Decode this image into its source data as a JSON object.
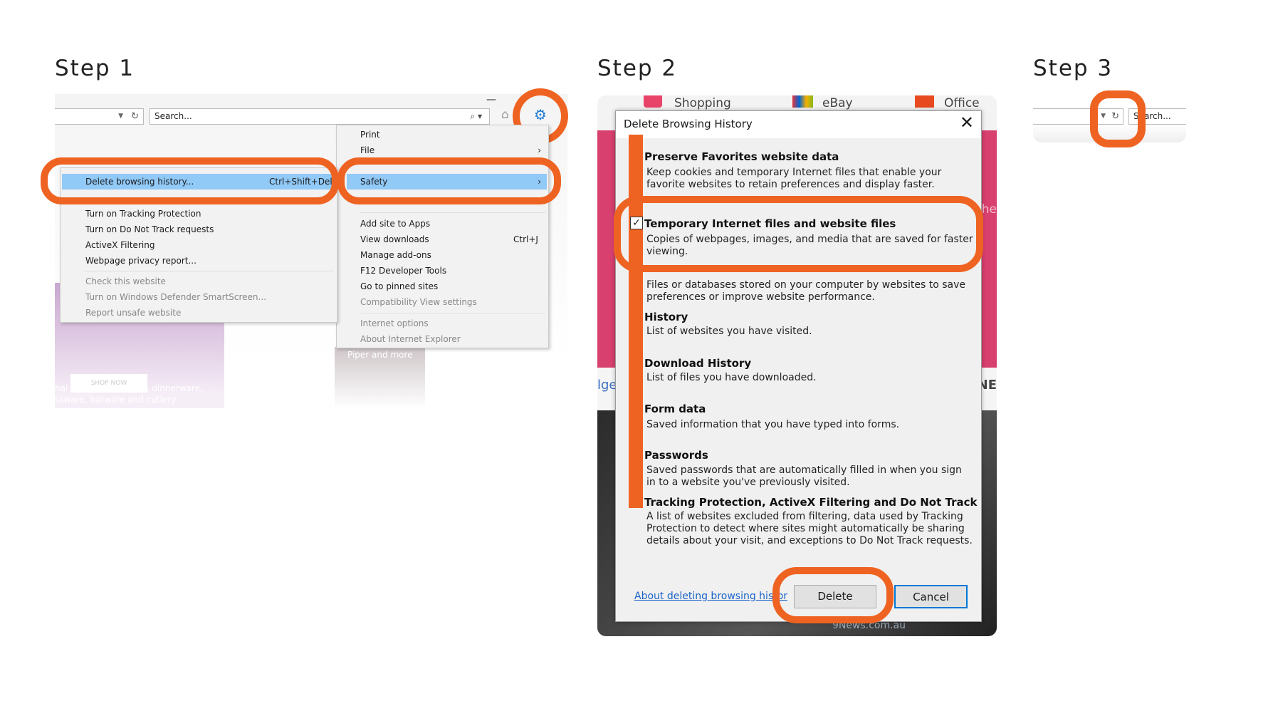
{
  "steps": [
    "Step 1",
    "Step 2",
    "Step 3"
  ],
  "accent_color": "#ef6322",
  "step1": {
    "search_placeholder": "Search...",
    "icons": [
      "dropdown-icon",
      "refresh-icon",
      "search-icon",
      "home-icon",
      "star-icon",
      "gear-icon",
      "minimize-icon"
    ],
    "safety_submenu": [
      {
        "label": "Delete browsing history...",
        "shortcut": "Ctrl+Shift+Del",
        "highlighted": true
      },
      {
        "label": "Turn on Tracking Protection"
      },
      {
        "label": "Turn on Do Not Track requests"
      },
      {
        "label": "ActiveX Filtering"
      },
      {
        "label": "Webpage privacy report..."
      },
      {
        "label": "Check this website",
        "disabled": true
      },
      {
        "label": "Turn on Windows Defender SmartScreen...",
        "disabled": true
      },
      {
        "label": "Report unsafe website",
        "disabled": true
      }
    ],
    "tools_menu": [
      {
        "label": "Print"
      },
      {
        "label": "File",
        "submenu": true
      },
      {
        "label": "Safety",
        "submenu": true,
        "highlighted": true
      },
      {
        "label": "Add site to Apps"
      },
      {
        "label": "View downloads",
        "shortcut": "Ctrl+J"
      },
      {
        "label": "Manage add-ons"
      },
      {
        "label": "F12 Developer Tools"
      },
      {
        "label": "Go to pinned sites"
      },
      {
        "label": "Compatibility View settings"
      },
      {
        "label": "Internet options",
        "disabled": true
      },
      {
        "label": "About Internet Explorer",
        "disabled": true
      }
    ],
    "background": {
      "promo_line1": "nal price of cookware, dinnerware,",
      "promo_line2": "ssware, barware and cutlery",
      "shop_now": "SHOP NOW",
      "piper": "Piper and more"
    }
  },
  "step2": {
    "favorites": [
      "Shopping",
      "eBay",
      "Office"
    ],
    "background": {
      "right1": "he",
      "left1": "lge",
      "right2": "NE",
      "footer": "9News.com.au"
    },
    "dialog": {
      "title": "Delete Browsing History",
      "items": [
        {
          "title": "Preserve Favorites website data",
          "desc": "Keep cookies and temporary Internet files that enable your favorite websites to retain preferences and display faster.",
          "checked": false
        },
        {
          "title": "Temporary Internet files and website files",
          "desc": "Copies of webpages, images, and media that are saved for faster viewing.",
          "checked": true
        },
        {
          "title": "",
          "desc": "Files or databases stored on your computer by websites to save preferences or improve website performance."
        },
        {
          "title": "History",
          "desc": "List of websites you have visited."
        },
        {
          "title": "Download History",
          "desc": "List of files you have downloaded."
        },
        {
          "title": "Form data",
          "desc": "Saved information that you have typed into forms."
        },
        {
          "title": "Passwords",
          "desc": "Saved passwords that are automatically filled in when you sign in to a website you've previously visited."
        },
        {
          "title": "Tracking Protection, ActiveX Filtering and Do Not Track",
          "desc": "A list of websites excluded from filtering, data used by Tracking Protection to detect where sites might automatically be sharing details about your visit, and exceptions to Do Not Track requests."
        }
      ],
      "link": "About deleting browsing histor",
      "delete_label": "Delete",
      "cancel_label": "Cancel"
    }
  },
  "step3": {
    "search_placeholder": "Search..."
  }
}
